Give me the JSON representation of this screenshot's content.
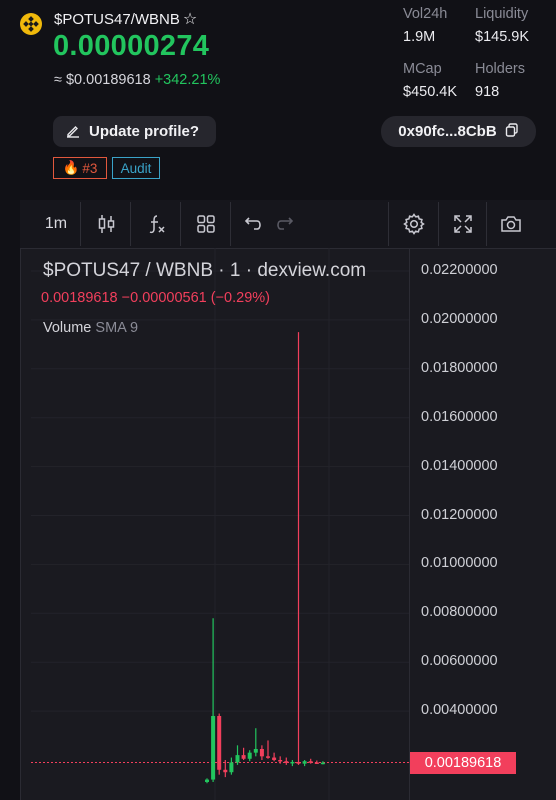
{
  "header": {
    "pair": "$POTUS47/WBNB",
    "price_native": "0.00000274",
    "price_usd": "≈ $0.00189618",
    "change": "+342.21%"
  },
  "stats": [
    {
      "label": "Vol24h",
      "value": "1.9M"
    },
    {
      "label": "Liquidity",
      "value": "$145.9K"
    },
    {
      "label": "MCap",
      "value": "$450.4K"
    },
    {
      "label": "Holders",
      "value": "918"
    }
  ],
  "actions": {
    "update_profile": "Update profile?",
    "address": "0x90fc...8CbB"
  },
  "badges": {
    "rank": "#3",
    "audit": "Audit"
  },
  "toolbar": {
    "interval": "1m"
  },
  "chart_header": {
    "title": "$POTUS47 / WBNB · 1 · dexview.com",
    "ohlc": "0.00189618 −0.00000561 (−0.29%)",
    "volume_label": "Volume",
    "volume_sma": "SMA 9"
  },
  "colors": {
    "up": "#22c55e",
    "down": "#f23f5c",
    "accent_audit": "#3aa3c8",
    "accent_hot": "#e2583d"
  },
  "chart_data": {
    "type": "candlestick",
    "y_ticks": [
      "0.02200000",
      "0.02000000",
      "0.01800000",
      "0.01600000",
      "0.01400000",
      "0.01200000",
      "0.01000000",
      "0.00800000",
      "0.00600000",
      "0.00400000"
    ],
    "current_price": "0.00189618",
    "ylim": [
      0.0011,
      0.0227
    ],
    "candles": [
      {
        "o": 0.0011,
        "h": 0.00125,
        "l": 0.00105,
        "c": 0.0012
      },
      {
        "o": 0.0012,
        "h": 0.0078,
        "l": 0.0011,
        "c": 0.0038
      },
      {
        "o": 0.0038,
        "h": 0.0039,
        "l": 0.0014,
        "c": 0.0016
      },
      {
        "o": 0.0016,
        "h": 0.002,
        "l": 0.0013,
        "c": 0.0015
      },
      {
        "o": 0.0015,
        "h": 0.0021,
        "l": 0.0014,
        "c": 0.0019
      },
      {
        "o": 0.0019,
        "h": 0.0026,
        "l": 0.0018,
        "c": 0.0022
      },
      {
        "o": 0.0022,
        "h": 0.0025,
        "l": 0.002,
        "c": 0.00205
      },
      {
        "o": 0.00205,
        "h": 0.0024,
        "l": 0.00195,
        "c": 0.0023
      },
      {
        "o": 0.0023,
        "h": 0.0033,
        "l": 0.00215,
        "c": 0.00245
      },
      {
        "o": 0.00245,
        "h": 0.0026,
        "l": 0.002,
        "c": 0.00215
      },
      {
        "o": 0.00215,
        "h": 0.0028,
        "l": 0.00205,
        "c": 0.0021
      },
      {
        "o": 0.0021,
        "h": 0.0023,
        "l": 0.00195,
        "c": 0.002
      },
      {
        "o": 0.002,
        "h": 0.00215,
        "l": 0.00185,
        "c": 0.00195
      },
      {
        "o": 0.00195,
        "h": 0.0021,
        "l": 0.0018,
        "c": 0.00188
      },
      {
        "o": 0.00188,
        "h": 0.002,
        "l": 0.00175,
        "c": 0.00192
      },
      {
        "o": 0.00192,
        "h": 0.0195,
        "l": 0.0018,
        "c": 0.00185
      },
      {
        "o": 0.00185,
        "h": 0.002,
        "l": 0.00175,
        "c": 0.00195
      },
      {
        "o": 0.00195,
        "h": 0.00205,
        "l": 0.00185,
        "c": 0.0019
      },
      {
        "o": 0.0019,
        "h": 0.00198,
        "l": 0.00184,
        "c": 0.00186
      },
      {
        "o": 0.00186,
        "h": 0.00195,
        "l": 0.00182,
        "c": 0.00189
      }
    ]
  }
}
